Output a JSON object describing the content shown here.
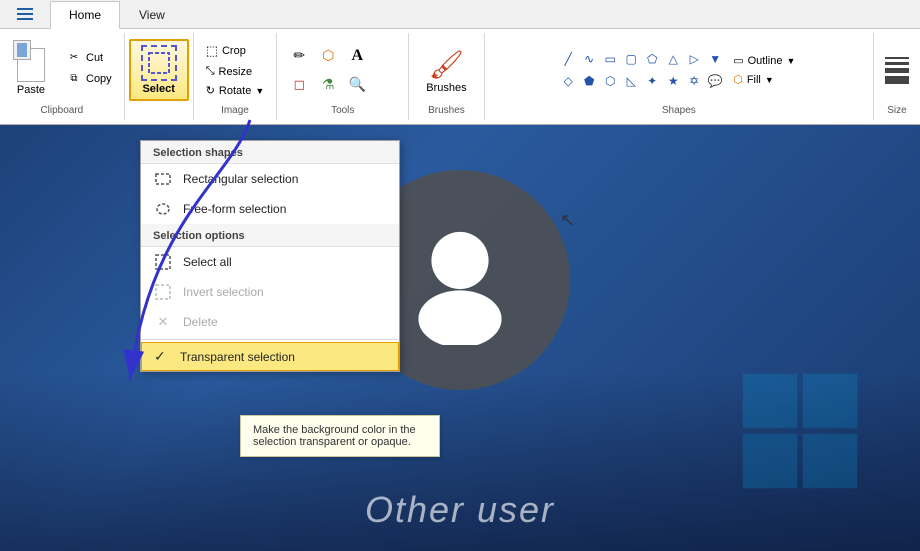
{
  "ribbon": {
    "tabs": [
      {
        "label": "Home",
        "active": true
      },
      {
        "label": "View",
        "active": false
      }
    ],
    "clipboard": {
      "group_label": "Clipboard",
      "paste_label": "Paste",
      "cut_label": "Cut",
      "copy_label": "Copy"
    },
    "image": {
      "group_label": "Image",
      "crop_label": "Crop",
      "resize_label": "Resize",
      "rotate_label": "Rotate"
    },
    "tools": {
      "group_label": "Tools"
    },
    "brushes": {
      "group_label": "Brushes",
      "label": "Brushes"
    },
    "shapes": {
      "group_label": "Shapes",
      "outline_label": "Outline",
      "fill_label": "Fill"
    },
    "size": {
      "group_label": "Size"
    },
    "select_button": {
      "label": "Select"
    }
  },
  "dropdown": {
    "section1_label": "Selection shapes",
    "item1_label": "Rectangular selection",
    "item2_label": "Free-form selection",
    "section2_label": "Selection options",
    "item3_label": "Select all",
    "item4_label": "Invert selection",
    "item5_label": "Delete",
    "item6_label": "Transparent selection"
  },
  "tooltip": {
    "text": "Make the background color in the selection transparent or opaque."
  },
  "background": {
    "other_user_text": "Other user"
  }
}
